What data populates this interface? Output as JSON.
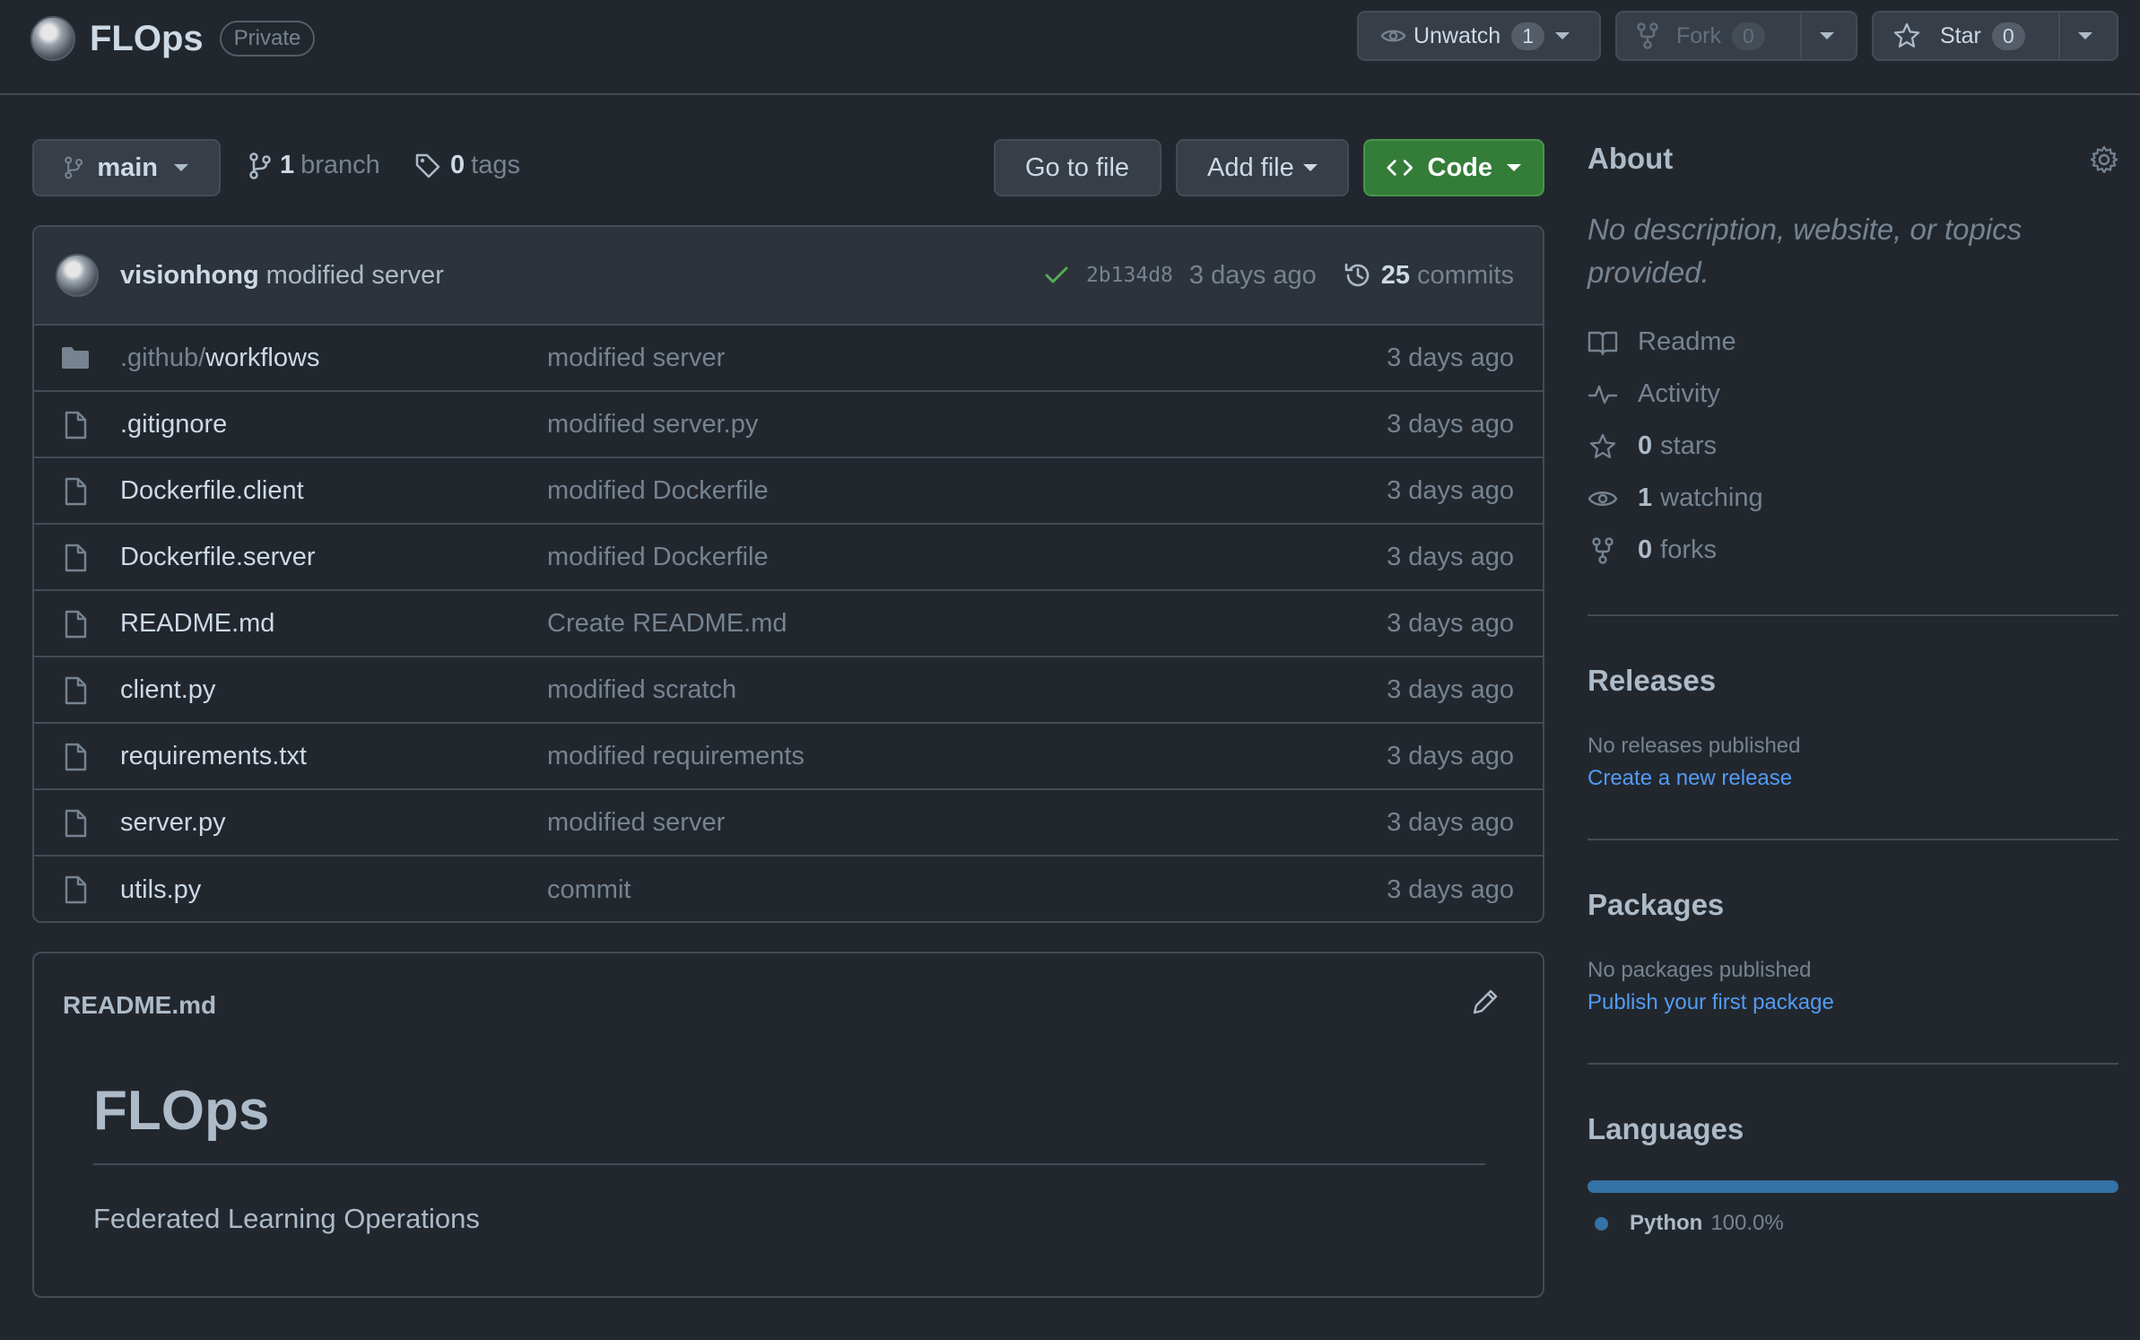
{
  "repo": {
    "name": "FLOps",
    "visibility": "Private"
  },
  "header_actions": {
    "unwatch_label": "Unwatch",
    "watch_count": "1",
    "fork_label": "Fork",
    "fork_count": "0",
    "star_label": "Star",
    "star_count": "0"
  },
  "toolbar": {
    "branch_name": "main",
    "branch_count": "1",
    "branch_label": "branch",
    "tag_count": "0",
    "tag_label": "tags",
    "go_to_file": "Go to file",
    "add_file": "Add file",
    "code": "Code"
  },
  "latest_commit": {
    "author": "visionhong",
    "message": "modified server",
    "sha": "2b134d8",
    "age": "3 days ago",
    "commit_count": "25",
    "commit_label": "commits"
  },
  "files": [
    {
      "type": "folder",
      "dim_prefix": ".github/",
      "name": "workflows",
      "commit": "modified server",
      "age": "3 days ago"
    },
    {
      "type": "file",
      "dim_prefix": "",
      "name": ".gitignore",
      "commit": "modified server.py",
      "age": "3 days ago"
    },
    {
      "type": "file",
      "dim_prefix": "",
      "name": "Dockerfile.client",
      "commit": "modified Dockerfile",
      "age": "3 days ago"
    },
    {
      "type": "file",
      "dim_prefix": "",
      "name": "Dockerfile.server",
      "commit": "modified Dockerfile",
      "age": "3 days ago"
    },
    {
      "type": "file",
      "dim_prefix": "",
      "name": "README.md",
      "commit": "Create README.md",
      "age": "3 days ago"
    },
    {
      "type": "file",
      "dim_prefix": "",
      "name": "client.py",
      "commit": "modified scratch",
      "age": "3 days ago"
    },
    {
      "type": "file",
      "dim_prefix": "",
      "name": "requirements.txt",
      "commit": "modified requirements",
      "age": "3 days ago"
    },
    {
      "type": "file",
      "dim_prefix": "",
      "name": "server.py",
      "commit": "modified server",
      "age": "3 days ago"
    },
    {
      "type": "file",
      "dim_prefix": "",
      "name": "utils.py",
      "commit": "commit",
      "age": "3 days ago"
    }
  ],
  "readme": {
    "filename": "README.md",
    "heading": "FLOps",
    "body": "Federated Learning Operations"
  },
  "about": {
    "title": "About",
    "description": "No description, website, or topics provided.",
    "readme": "Readme",
    "activity": "Activity",
    "stars_count": "0",
    "stars_label": "stars",
    "watching_count": "1",
    "watching_label": "watching",
    "forks_count": "0",
    "forks_label": "forks"
  },
  "releases": {
    "title": "Releases",
    "status": "No releases published",
    "link": "Create a new release"
  },
  "packages": {
    "title": "Packages",
    "status": "No packages published",
    "link": "Publish your first package"
  },
  "languages": {
    "title": "Languages",
    "items": [
      {
        "name": "Python",
        "percent": "100.0%",
        "color": "#3572a5"
      }
    ]
  },
  "colors": {
    "background": "#22272e",
    "code_button": "#347d39",
    "link": "#539bf5",
    "check": "#57ab5a"
  }
}
